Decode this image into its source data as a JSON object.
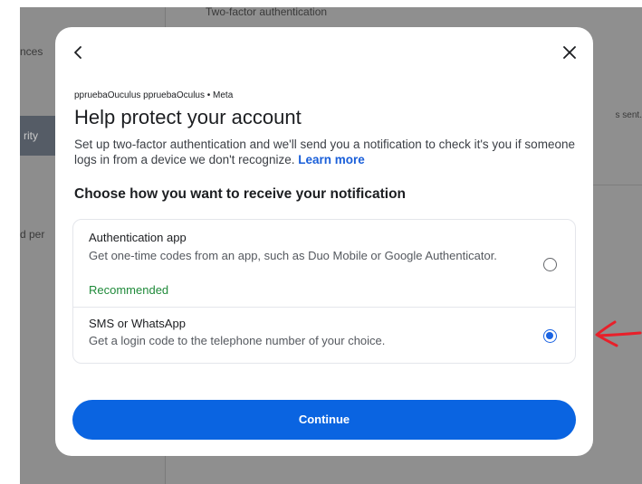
{
  "background": {
    "sidebar": {
      "item_preferences": "nces",
      "item_security": "rity",
      "item_permissions": "d per"
    },
    "main": {
      "section_title": "Two-factor authentication",
      "status_text": "s sent."
    }
  },
  "modal": {
    "account_breadcrumb": "ppruebaOuculus ppruebaOculus • Meta",
    "title": "Help protect your account",
    "description": "Set up two-factor authentication and we'll send you a notification to check it's you if someone logs in from a device we don't recognize.",
    "learn_more": "Learn more",
    "subtitle": "Choose how you want to receive your notification",
    "options": [
      {
        "title": "Authentication app",
        "description": "Get one-time codes from an app, such as Duo Mobile or Google Authenticator.",
        "badge": "Recommended",
        "selected": false
      },
      {
        "title": "SMS or WhatsApp",
        "description": "Get a login code to the telephone number of your choice.",
        "selected": true
      }
    ],
    "continue_label": "Continue"
  },
  "colors": {
    "accent": "#0a64e1",
    "recommended": "#1f8a3a",
    "annotation": "#e8202a"
  },
  "icons": {
    "back": "chevron-left-icon",
    "close": "close-icon",
    "annotation": "red-arrow-annotation"
  }
}
